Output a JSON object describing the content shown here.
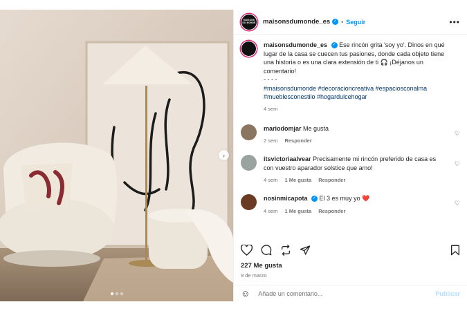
{
  "post": {
    "username": "maisonsdumonde_es",
    "avatar_text": "MAISONS DU MONDE",
    "follow_label": "Seguir",
    "more_icon": "more-options-icon",
    "carousel_dots": 3,
    "carousel_active": 0
  },
  "caption": {
    "username": "maisonsdumonde_es",
    "text": "Ese rincón grita 'soy yo'. Dinos en qué lugar de la casa se cuecen tus pasiones, donde cada objeto tiene una historia o es una clara extensión de ti 🎧 ¡Déjanos un comentario!",
    "separator": "- - - -",
    "hashtags": "#maisonsdumonde #decoracioncreativa #espaciosconalma #mueblesconestilo #hogardulcehogar",
    "time": "4 sem"
  },
  "comments": [
    {
      "username": "mariodomjar",
      "text": "Me gusta",
      "time": "2 sem",
      "likes": "",
      "reply": "Responder",
      "avatar_color": "#8a7560"
    },
    {
      "username": "itsvictoriaalvear",
      "text": "Precisamente mi rincón preferido de casa es con vuestro aparador solstice que amo!",
      "time": "4 sem",
      "likes": "1 Me gusta",
      "reply": "Responder",
      "avatar_color": "#9aa3a0"
    },
    {
      "username": "nosinmicapota",
      "text": "El 3 es muy yo",
      "emoji": "❤️",
      "time": "4 sem",
      "likes": "1 Me gusta",
      "reply": "Responder",
      "avatar_color": "#6b3a22"
    }
  ],
  "stats": {
    "likes": "227 Me gusta",
    "date": "9 de marzo"
  },
  "add_comment": {
    "placeholder": "Añade un comentario...",
    "publish_label": "Publicar"
  },
  "colors": {
    "accent": "#0095f6",
    "hashtag": "#00376b",
    "muted": "#737373",
    "heart": "#ed4956"
  }
}
